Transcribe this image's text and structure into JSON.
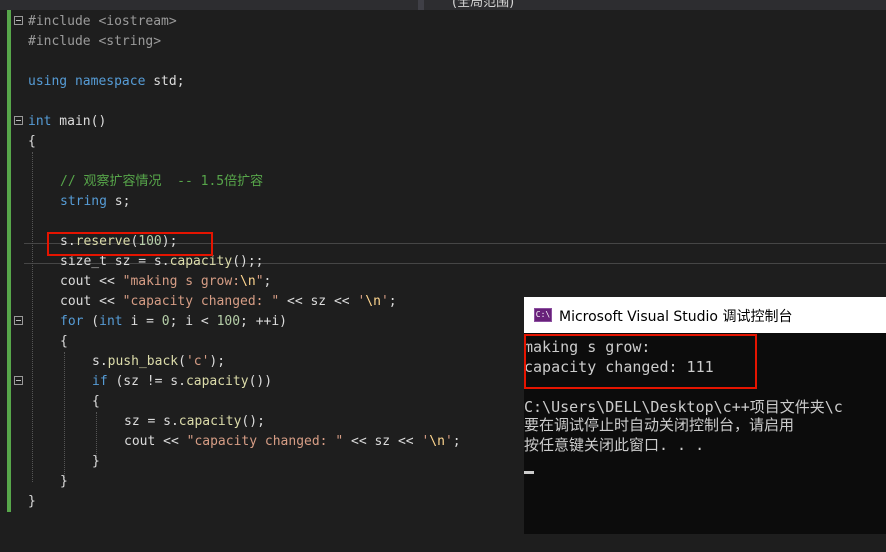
{
  "toolbar": {
    "scope_label": "(全局范围)"
  },
  "code": {
    "include_iostream": "#include <iostream>",
    "include_string": "#include <string>",
    "using_kw": "using namespace",
    "using_rest": " std;",
    "int_kw": "int",
    "main_rest": " main()",
    "open_brace": "{",
    "comment": "// 观察扩容情况  -- 1.5倍扩容",
    "string_type": "string",
    "string_rest": " s;",
    "reserve_pre": "s.",
    "reserve_fn": "reserve",
    "reserve_open": "(",
    "reserve_num": "100",
    "reserve_close": ");",
    "sizet_pre": "size_t sz = s.",
    "sizet_fn": "capacity",
    "sizet_post": "();;",
    "cout1_pre": "cout << ",
    "cout1_str": "\"making s grow:",
    "cout1_esc": "\\n",
    "cout1_end_str": "\"",
    "cout1_post": ";",
    "cout2_pre": "cout << ",
    "cout2_str": "\"capacity changed: \"",
    "cout2_mid": " << sz << ",
    "cout2_q1": "'",
    "cout2_esc": "\\n",
    "cout2_q2": "'",
    "cout2_post": ";",
    "for_kw": "for",
    "for_p1": " (",
    "for_int": "int",
    "for_p2": " i = ",
    "for_n0": "0",
    "for_p3": "; i < ",
    "for_n100": "100",
    "for_p4": "; ++i)",
    "inner_open": "{",
    "push_pre": "s.",
    "push_fn": "push_back",
    "push_open": "(",
    "push_chr": "'c'",
    "push_close": ");",
    "if_kw": "if",
    "if_p1": " (sz != s.",
    "if_fn": "capacity",
    "if_p2": "())",
    "if_open": "{",
    "assign_pre": "sz = s.",
    "assign_fn": "capacity",
    "assign_post": "();",
    "cout3_pre": "cout << ",
    "cout3_str": "\"capacity changed: \"",
    "cout3_mid": " << sz << ",
    "cout3_q1": "'",
    "cout3_esc": "\\n",
    "cout3_q2": "'",
    "cout3_post": ";",
    "if_close": "}",
    "for_close": "}",
    "main_close": "}"
  },
  "console": {
    "title": "Microsoft Visual Studio 调试控制台",
    "icon_text": "C:\\",
    "lines": [
      "making s grow:",
      "capacity changed: 111",
      "",
      "C:\\Users\\DELL\\Desktop\\c++项目文件夹\\c",
      "要在调试停止时自动关闭控制台，请启用",
      "按任意键关闭此窗口. . ."
    ]
  },
  "colors": {
    "editor_bg": "#1e1e1e",
    "keyword": "#569cd6",
    "string": "#d69d85",
    "comment": "#57a64a",
    "highlight_box": "#e51400",
    "console_bg": "#0c0c0c"
  }
}
